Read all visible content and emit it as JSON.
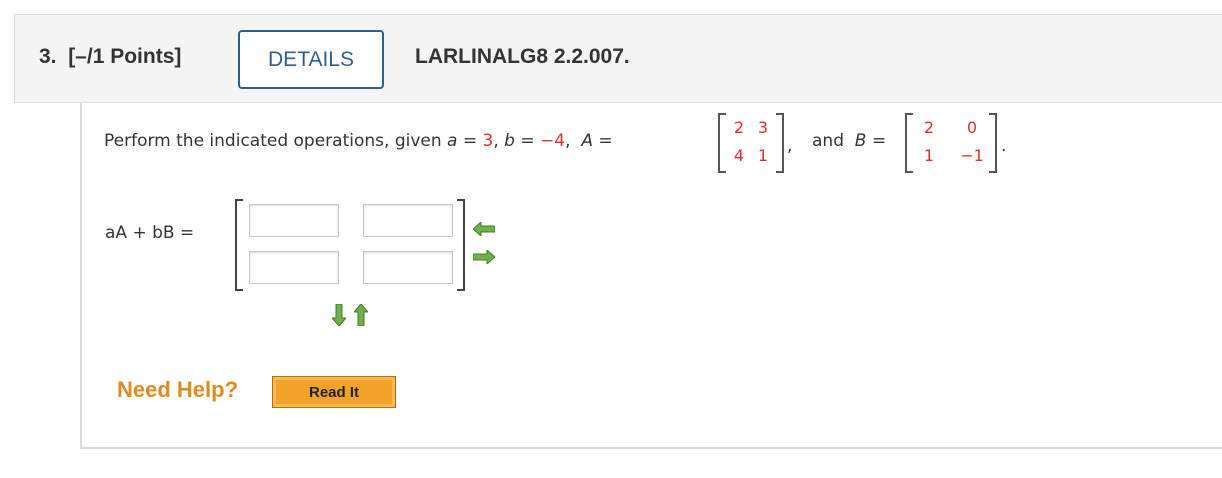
{
  "header": {
    "number_label": "3.",
    "points_label": "[–/1 Points]",
    "details_label": "DETAILS",
    "problem_code": "LARLINALG8 2.2.007."
  },
  "prompt": {
    "text_before": "Perform the indicated operations, given",
    "a_var": "a",
    "a_value": "3",
    "b_var": "b",
    "b_value": "−4",
    "A_var": "A",
    "and_text": "and",
    "B_var": "B",
    "equals": "=",
    "comma": ",",
    "period": "."
  },
  "matrix_A": [
    [
      "2",
      "3"
    ],
    [
      "4",
      "1"
    ]
  ],
  "matrix_B": [
    [
      "2",
      "0"
    ],
    [
      "1",
      "−1"
    ]
  ],
  "answer": {
    "expression": "aA + bB =",
    "cells": [
      [
        "",
        ""
      ],
      [
        "",
        ""
      ]
    ]
  },
  "help": {
    "need_help_label": "Need Help?",
    "read_it_label": "Read It"
  },
  "colors": {
    "given_value": "#e0302a",
    "details_border": "#2f5e8c",
    "help_text": "#e08a1e",
    "read_it_bg": "#f3a229",
    "arrow_green": "#5a9e3a"
  }
}
